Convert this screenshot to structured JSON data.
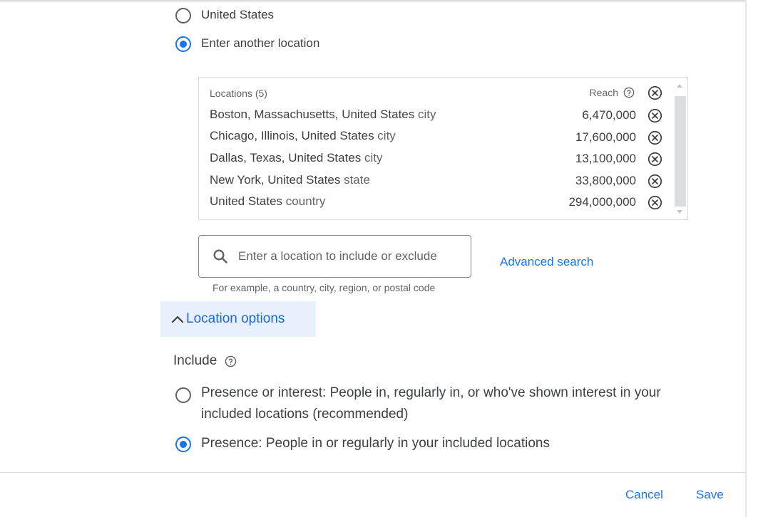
{
  "location_choice": {
    "options": [
      {
        "label": "United States",
        "checked": false
      },
      {
        "label": "Enter another location",
        "checked": true
      }
    ]
  },
  "locations_table": {
    "header": "Locations (5)",
    "reach_header": "Reach",
    "rows": [
      {
        "name": "Boston, Massachusetts, United States",
        "type": "city",
        "reach": "6,470,000"
      },
      {
        "name": "Chicago, Illinois, United States",
        "type": "city",
        "reach": "17,600,000"
      },
      {
        "name": "Dallas, Texas, United States",
        "type": "city",
        "reach": "13,100,000"
      },
      {
        "name": "New York, United States",
        "type": "state",
        "reach": "33,800,000"
      },
      {
        "name": "United States",
        "type": "country",
        "reach": "294,000,000"
      }
    ]
  },
  "search": {
    "placeholder": "Enter a location to include or exclude",
    "value": "",
    "hint": "For example, a country, city, region, or postal code",
    "advanced_link": "Advanced search"
  },
  "location_options": {
    "toggle_label": "Location options",
    "include_label": "Include",
    "include_options": [
      {
        "label": "Presence or interest: People in, regularly in, or who've shown interest in your included locations (recommended)",
        "checked": false
      },
      {
        "label": "Presence: People in or regularly in your included locations",
        "checked": true
      }
    ]
  },
  "footer": {
    "cancel_label": "Cancel",
    "save_label": "Save"
  },
  "colors": {
    "accent": "#1a73e8",
    "options_bg": "#e8f0fe"
  }
}
